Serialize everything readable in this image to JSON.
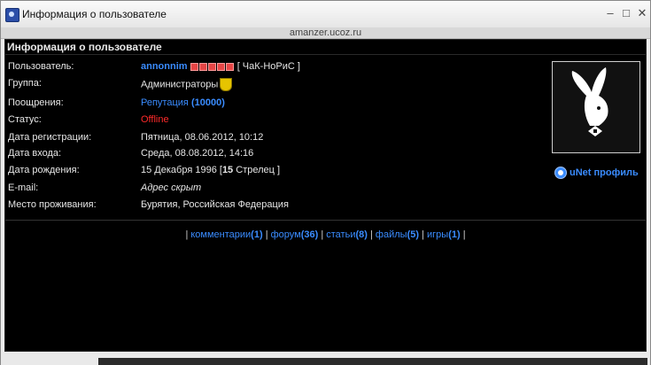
{
  "window": {
    "title": "Информация о пользователе",
    "controls": {
      "minimize": "–",
      "maximize": "□",
      "close": "✕"
    }
  },
  "address": "amanzer.ucoz.ru",
  "header": "Информация о пользователе",
  "profile": {
    "user_label": "Пользователь:",
    "user_name": "annonnim",
    "user_rank": "[ ЧаК-НоРиС ]",
    "group_label": "Группа:",
    "group_value": "Администраторы",
    "rewards_label": "Поощрения:",
    "rewards_text": "Репутация",
    "rewards_value": "(10000)",
    "status_label": "Статус:",
    "status_value": "Offline",
    "reg_label": "Дата регистрации:",
    "reg_value": "Пятница, 08.06.2012, 10:12",
    "login_label": "Дата входа:",
    "login_value": "Среда, 08.08.2012, 14:16",
    "birth_label": "Дата рождения:",
    "birth_date": "15 Декабря 1996",
    "birth_age_open": "[",
    "birth_age": "15",
    "birth_sign": "Стрелец ]",
    "email_label": "E-mail:",
    "email_value": "Адрес скрыт",
    "location_label": "Место проживания:",
    "location_value": "Бурятия, Российская Федерация"
  },
  "unet_profile": "uNet профиль",
  "links": {
    "comments": "комментарии",
    "comments_count": "(1)",
    "forum": "форум",
    "forum_count": "(36)",
    "articles": "статьи",
    "articles_count": "(8)",
    "files": "файлы",
    "files_count": "(5)",
    "games": "игры",
    "games_count": "(1)"
  },
  "colors": {
    "accent": "#3a8cff",
    "offline": "#ff2a2a",
    "background": "#000000"
  }
}
